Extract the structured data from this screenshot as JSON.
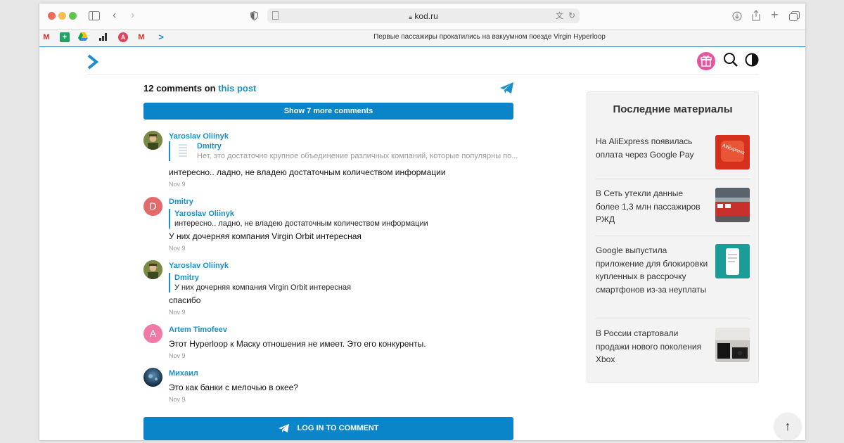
{
  "browser": {
    "url": "kod.ru",
    "tab_title": "Первые пассажиры прокатились на вакуумном поезде Virgin Hyperloop",
    "favicons": [
      "gmail-icon",
      "sheets-icon",
      "drive-icon",
      "analytics-icon",
      "app-icon",
      "gmail-icon",
      "kod-icon"
    ]
  },
  "comments_header": {
    "count_label": "12 comments on",
    "link_label": "this post"
  },
  "show_more_label": "Show 7 more comments",
  "comments": [
    {
      "author": "Yaroslav Oliinyk",
      "quote_author": "Dmitry",
      "quote_text": "Нет, это достаточно крупное объединение различных компаний, которые популярны по...",
      "text": "интересно.. ладно, не владею достаточным количеством информации",
      "date": "Nov 9"
    },
    {
      "author": "Dmitry",
      "avatar_letter": "D",
      "avatar_color": "#e46a6a",
      "quote_author": "Yaroslav Oliinyk",
      "quote_text": "интересно.. ладно, не владею достаточным количеством информации",
      "text": "У них дочерняя компания Virgin Orbit интересная",
      "date": "Nov 9"
    },
    {
      "author": "Yaroslav Oliinyk",
      "quote_author": "Dmitry",
      "quote_text": "У них дочерняя компания Virgin Orbit интересная",
      "text": "спасибо",
      "date": "Nov 9"
    },
    {
      "author": "Artem Timofeev",
      "avatar_letter": "A",
      "avatar_color": "#f07aa5",
      "text": "Этот Hyperloop к Маску отношения не имеет. Это его конкуренты.",
      "date": "Nov 9"
    },
    {
      "author": "Михаил",
      "text": "Это как банки с мелочью в океe?",
      "date": "Nov 9"
    }
  ],
  "login_label": "LOG IN TO COMMENT",
  "sidebar": {
    "title": "Последние материалы",
    "items": [
      {
        "text": "На AliExpress появилась оплата через Google Pay",
        "thumb": "aliexpress"
      },
      {
        "text": "В Сеть утекли данные более 1,3 млн пассажиров РЖД",
        "thumb": "train"
      },
      {
        "text": "Google выпустила приложение для блокировки купленных в рассрочку смартфонов из-за неуплаты",
        "thumb": "phone"
      },
      {
        "text": "В России стартовали продажи нового поколения Xbox",
        "thumb": "xbox"
      }
    ]
  },
  "colors": {
    "accent": "#0a85c9",
    "link": "#1a8fcc",
    "gift": "#e6559c"
  }
}
